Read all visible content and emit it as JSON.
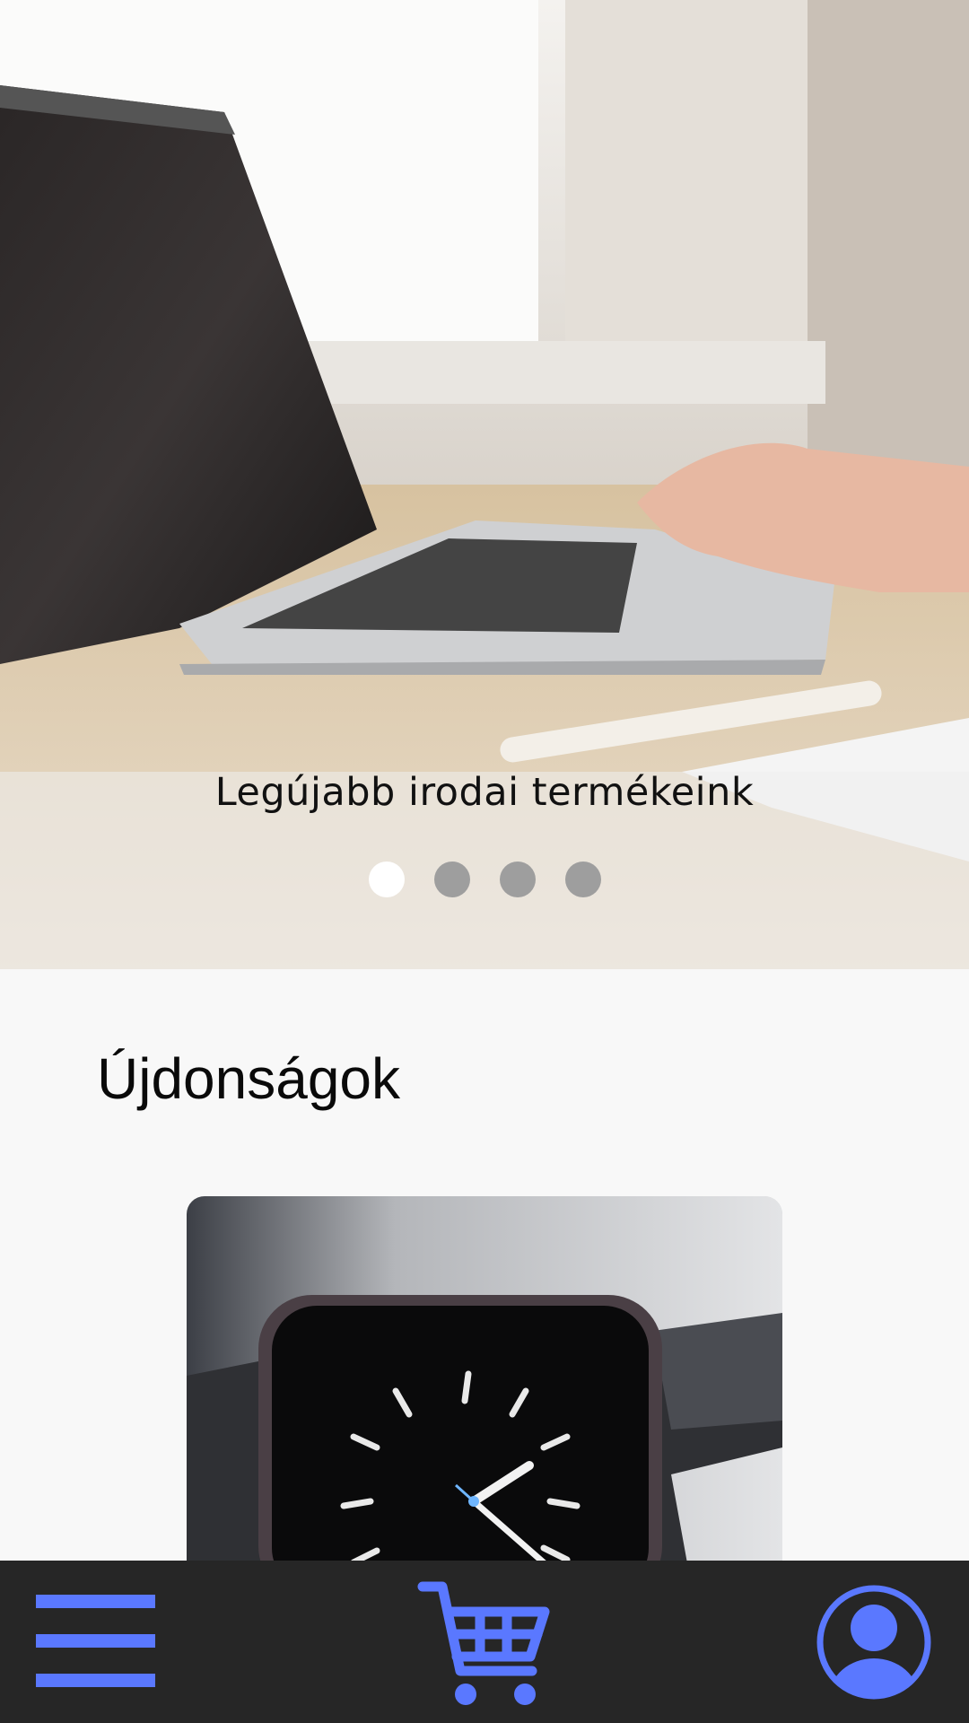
{
  "hero": {
    "caption": "Legújabb irodai termékeink",
    "slide_count": 4,
    "active_slide": 1,
    "image": "laptop-on-desk-photo"
  },
  "section": {
    "title": "Újdonságok"
  },
  "product": {
    "image": "smartwatch-photo"
  },
  "bottom_nav": {
    "menu_icon": "hamburger-menu-icon",
    "cart_icon": "shopping-cart-icon",
    "profile_icon": "user-profile-icon",
    "accent_color": "#5a78ff",
    "background_color": "#262626"
  }
}
